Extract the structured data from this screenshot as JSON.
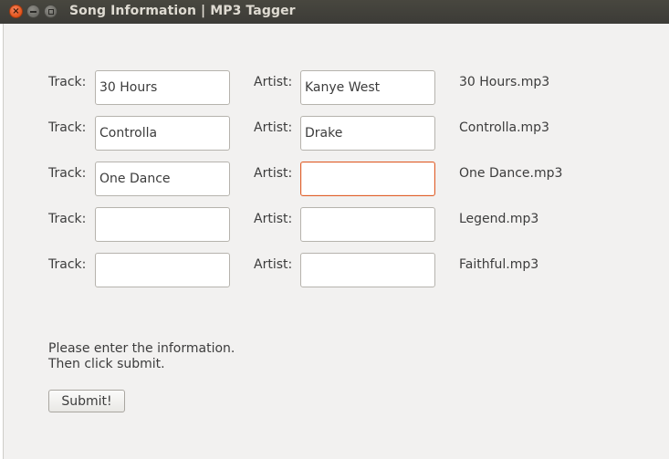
{
  "window": {
    "title": "Song Information | MP3 Tagger"
  },
  "form": {
    "track_label": "Track:",
    "artist_label": "Artist:",
    "rows": [
      {
        "track": "30 Hours",
        "artist": "Kanye West",
        "filename": "30 Hours.mp3"
      },
      {
        "track": "Controlla",
        "artist": "Drake",
        "filename": "Controlla.mp3"
      },
      {
        "track": "One Dance",
        "artist": "",
        "filename": "One Dance.mp3"
      },
      {
        "track": "",
        "artist": "",
        "filename": "Legend.mp3"
      },
      {
        "track": "",
        "artist": "",
        "filename": "Faithful.mp3"
      }
    ],
    "focused_field": "rows.2.artist"
  },
  "status": {
    "line1": "Please enter the information.",
    "line2": "Then click submit."
  },
  "actions": {
    "submit_label": "Submit!"
  },
  "colors": {
    "focus_border": "#e0602b",
    "close_button": "#e2531a",
    "window_bg": "#f2f1f0"
  }
}
